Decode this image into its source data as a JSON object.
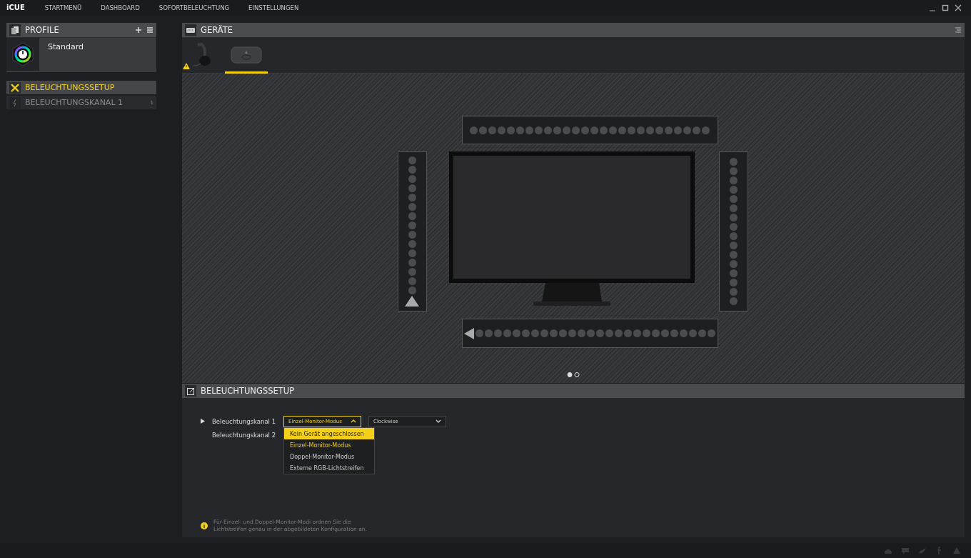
{
  "app": {
    "brand": "iCUE",
    "nav": [
      {
        "label": "STARTMENÜ",
        "selected": false
      },
      {
        "label": "DASHBOARD",
        "selected": false
      },
      {
        "label": "SOFORTBELEUCHTUNG",
        "selected": false
      },
      {
        "label": "EINSTELLUNGEN",
        "selected": false
      }
    ]
  },
  "profiles": {
    "title": "PROFILE",
    "items": [
      {
        "name": "Standard",
        "selected": true
      }
    ]
  },
  "sidebar": {
    "items": [
      {
        "kind": "setup",
        "label": "BELEUCHTUNGSSETUP",
        "selected": true
      },
      {
        "kind": "channel",
        "label": "BELEUCHTUNGSKANAL 1",
        "count": "1",
        "selected": false
      }
    ]
  },
  "devices": {
    "title": "GERÄTE",
    "items": [
      {
        "kind": "headset",
        "warning": true,
        "selected": false
      },
      {
        "kind": "hub",
        "warning": false,
        "selected": true
      }
    ],
    "pages": [
      {
        "selected": true
      },
      {
        "selected": false
      }
    ]
  },
  "setup": {
    "title": "BELEUCHTUNGSSETUP",
    "channels": [
      {
        "label": "Beleuchtungskanal 1",
        "expanded": true,
        "mode": "Einzel-Monitor-Modus",
        "direction": "Clockwise",
        "menu_open": true
      },
      {
        "label": "Beleuchtungskanal 2",
        "expanded": false
      }
    ],
    "options": [
      {
        "label": "Kein Gerät angeschlossen",
        "highlighted": true,
        "selected": false
      },
      {
        "label": "Einzel-Monitor-Modus",
        "highlighted": false,
        "selected": true
      },
      {
        "label": "Doppel-Monitor-Modus",
        "highlighted": false,
        "selected": false
      },
      {
        "label": "Externe RGB-Lichtstreifen",
        "highlighted": false,
        "selected": false
      }
    ],
    "note": "Für Einzel- und Doppel-Monitor-Modi ordnen Sie die Lichtstreifen genau in der abgebildeten Konfiguration an."
  }
}
